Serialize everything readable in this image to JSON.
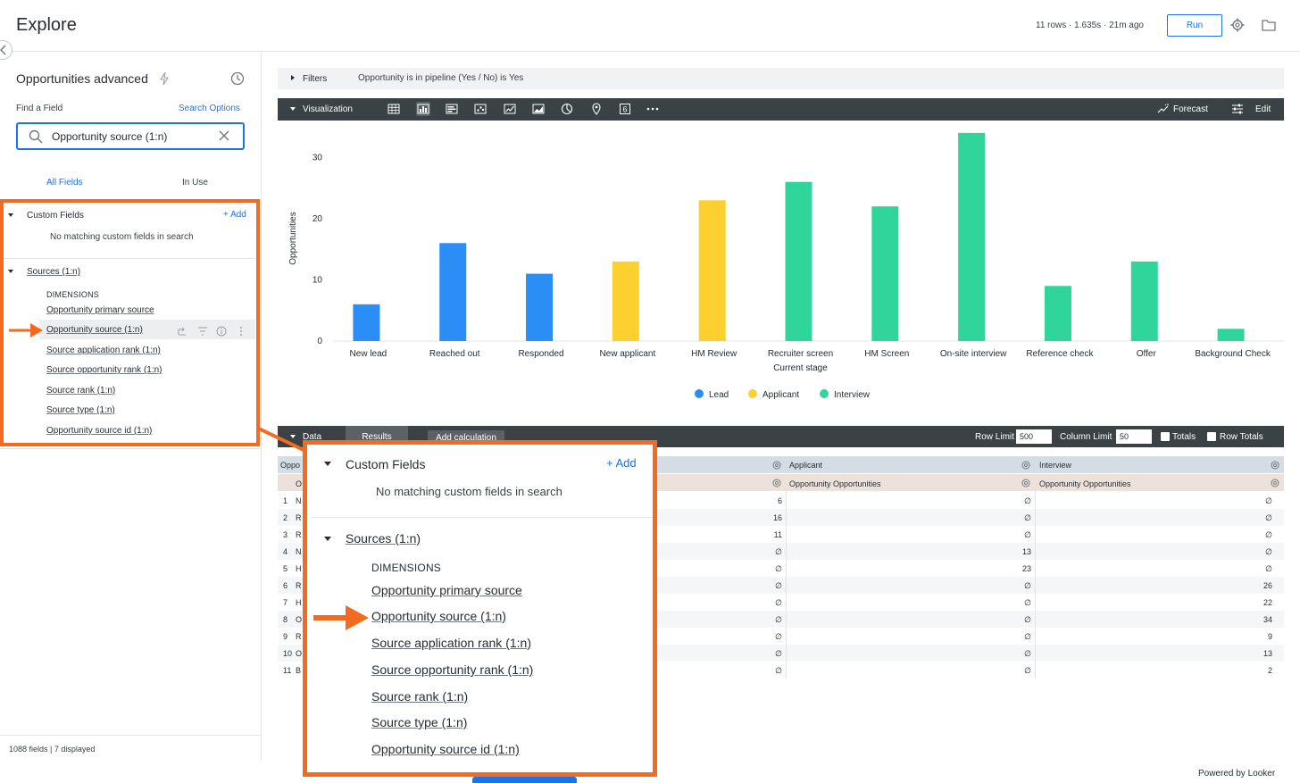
{
  "header": {
    "title": "Explore",
    "meta": "11 rows · 1.635s · 21m ago",
    "run_label": "Run"
  },
  "left": {
    "explore_name": "Opportunities advanced",
    "find_label": "Find a Field",
    "search_options": "Search Options",
    "search_value": "Opportunity source (1:n)",
    "tabs": {
      "all": "All Fields",
      "in_use": "In Use"
    },
    "custom_fields": {
      "title": "Custom Fields",
      "add": "+ Add",
      "empty": "No matching custom fields in search"
    },
    "sources": {
      "title": "Sources",
      "suffix": "(1:n)",
      "dimensions_label": "DIMENSIONS",
      "items": [
        {
          "label": "Opportunity primary source"
        },
        {
          "label": "Opportunity source (1:n)"
        },
        {
          "label": "Source application rank (1:n)"
        },
        {
          "label": "Source opportunity rank (1:n)"
        },
        {
          "label": "Source rank (1:n)"
        },
        {
          "label": "Source type (1:n)"
        },
        {
          "label": "Opportunity source id (1:n)"
        }
      ]
    },
    "footer": "1088 fields | 7 displayed"
  },
  "filters": {
    "label": "Filters",
    "value": "Opportunity is in pipeline (Yes / No) is Yes"
  },
  "visualization": {
    "label": "Visualization",
    "forecast": "Forecast",
    "edit": "Edit"
  },
  "chart_data": {
    "type": "bar",
    "ylabel": "Opportunities",
    "ylim": [
      0,
      35
    ],
    "yticks": [
      0,
      10,
      20,
      30
    ],
    "categories": [
      "New lead",
      "Reached out",
      "Responded",
      "New applicant",
      "HM Review",
      "Recruiter screen",
      "HM Screen",
      "On-site interview",
      "Reference check",
      "Offer",
      "Background Check"
    ],
    "category_sublabels": [
      "",
      "",
      "",
      "",
      "",
      "Current stage",
      "",
      "",
      "",
      "",
      ""
    ],
    "series": [
      {
        "name": "Lead",
        "color": "#2b8ef7",
        "values": [
          6,
          16,
          11,
          null,
          null,
          null,
          null,
          null,
          null,
          null,
          null
        ]
      },
      {
        "name": "Applicant",
        "color": "#fcd12f",
        "values": [
          null,
          null,
          null,
          13,
          23,
          null,
          null,
          null,
          null,
          null,
          null
        ]
      },
      {
        "name": "Interview",
        "color": "#2fd59b",
        "values": [
          null,
          null,
          null,
          null,
          null,
          26,
          22,
          34,
          9,
          13,
          2
        ]
      }
    ],
    "legend_position": "bottom",
    "grid": false
  },
  "data_panel": {
    "label": "Data",
    "results": "Results",
    "add_calculation": "Add calculation",
    "row_limit_label": "Row Limit",
    "row_limit": "500",
    "column_limit_label": "Column Limit",
    "column_limit": "50",
    "totals": "Totals",
    "row_totals": "Row Totals"
  },
  "table": {
    "col0_header": "Oppo",
    "col0_sub": "O",
    "pivot_headers": [
      "Applicant",
      "Interview"
    ],
    "measure_header": "Opportunity Opportunities",
    "rows": [
      {
        "n": "1",
        "label": "N",
        "lead": "6",
        "applicant": "∅",
        "interview": "∅"
      },
      {
        "n": "2",
        "label": "R",
        "lead": "16",
        "applicant": "∅",
        "interview": "∅"
      },
      {
        "n": "3",
        "label": "R",
        "lead": "11",
        "applicant": "∅",
        "interview": "∅"
      },
      {
        "n": "4",
        "label": "N",
        "lead": "∅",
        "applicant": "13",
        "interview": "∅"
      },
      {
        "n": "5",
        "label": "H",
        "lead": "∅",
        "applicant": "23",
        "interview": "∅"
      },
      {
        "n": "6",
        "label": "R",
        "lead": "∅",
        "applicant": "∅",
        "interview": "26"
      },
      {
        "n": "7",
        "label": "H",
        "lead": "∅",
        "applicant": "∅",
        "interview": "22"
      },
      {
        "n": "8",
        "label": "O",
        "lead": "∅",
        "applicant": "∅",
        "interview": "34"
      },
      {
        "n": "9",
        "label": "R",
        "lead": "∅",
        "applicant": "∅",
        "interview": "9"
      },
      {
        "n": "10",
        "label": "O",
        "lead": "∅",
        "applicant": "∅",
        "interview": "13"
      },
      {
        "n": "11",
        "label": "B",
        "lead": "∅",
        "applicant": "∅",
        "interview": "2"
      }
    ]
  },
  "powered_by": "Powered by",
  "brand": "Looker",
  "colors": {
    "accent": "#1a73e8",
    "highlight": "#f26b21",
    "toolbar": "#3a4245"
  }
}
